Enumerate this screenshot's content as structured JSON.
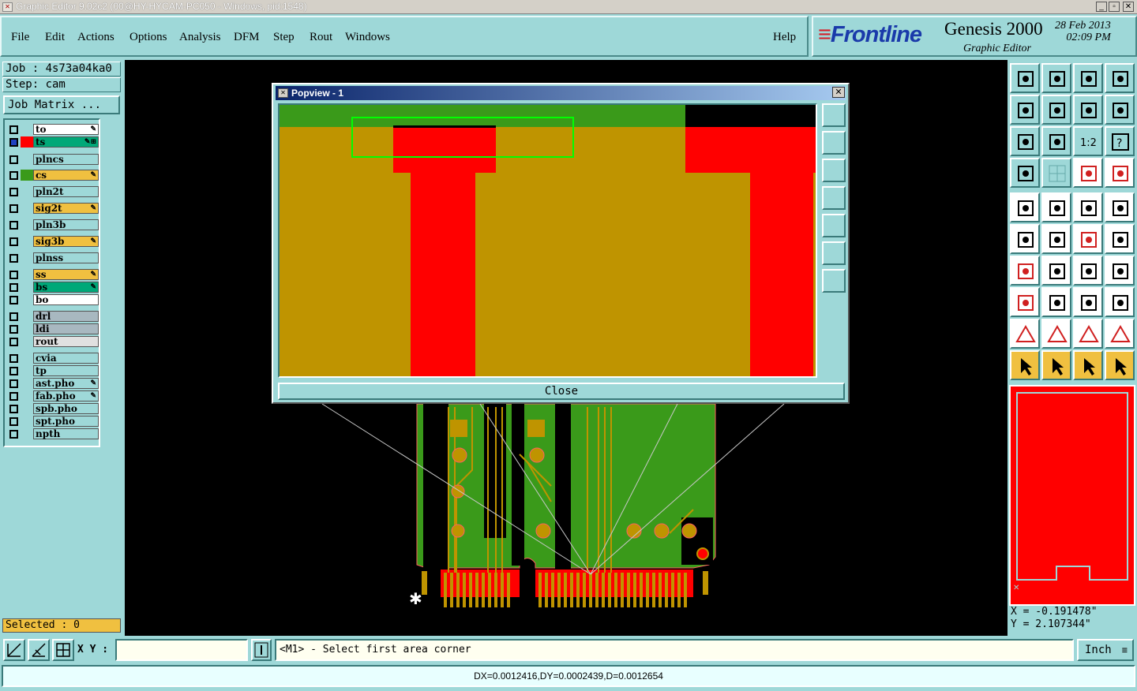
{
  "window": {
    "title": "Graphic Editor 9.02c2 (00@HY-HYCAM-PC050 - Windows, pid:1548)"
  },
  "menu": [
    "File",
    "Edit",
    "Actions",
    "Options",
    "Analysis",
    "DFM",
    "Step",
    "Rout",
    "Windows"
  ],
  "help_label": "Help",
  "brand": {
    "logo": "Frontline",
    "product": "Genesis 2000",
    "subtitle": "Graphic Editor",
    "date": "28 Feb 2013",
    "time": "02:09 PM"
  },
  "job": {
    "job_label": "Job : 4s73a04ka0",
    "step_label": "Step: cam",
    "matrix_button": "Job Matrix ..."
  },
  "layers": [
    {
      "name": "to",
      "bg": "#ffffff",
      "swatch": "",
      "mark": "✎"
    },
    {
      "name": "ts",
      "bg": "#00a878",
      "swatch": "#ff0000",
      "mark": "✎⊞",
      "active": true
    },
    {
      "name": "plncs",
      "bg": "#9ed8d8",
      "swatch": "",
      "mark": ""
    },
    {
      "name": "cs",
      "bg": "#f0c040",
      "swatch": "#3a9a1a",
      "mark": "✎"
    },
    {
      "name": "pln2t",
      "bg": "#9ed8d8",
      "swatch": "",
      "mark": ""
    },
    {
      "name": "sig2t",
      "bg": "#f0c040",
      "swatch": "",
      "mark": "✎"
    },
    {
      "name": "pln3b",
      "bg": "#9ed8d8",
      "swatch": "",
      "mark": ""
    },
    {
      "name": "sig3b",
      "bg": "#f0c040",
      "swatch": "",
      "mark": "✎"
    },
    {
      "name": "plnss",
      "bg": "#9ed8d8",
      "swatch": "",
      "mark": ""
    },
    {
      "name": "ss",
      "bg": "#f0c040",
      "swatch": "",
      "mark": "✎"
    },
    {
      "name": "bs",
      "bg": "#00a878",
      "swatch": "",
      "mark": "✎"
    },
    {
      "name": "bo",
      "bg": "#ffffff",
      "swatch": "",
      "mark": ""
    },
    {
      "name": "drl",
      "bg": "#a8b8c0",
      "swatch": "",
      "mark": ""
    },
    {
      "name": "ldi",
      "bg": "#a8b8c0",
      "swatch": "",
      "mark": ""
    },
    {
      "name": "rout",
      "bg": "#e0e0e0",
      "swatch": "",
      "mark": ""
    },
    {
      "name": "cvia",
      "bg": "#9ed8d8",
      "swatch": "",
      "mark": ""
    },
    {
      "name": "tp",
      "bg": "#9ed8d8",
      "swatch": "",
      "mark": ""
    },
    {
      "name": "ast.pho",
      "bg": "#9ed8d8",
      "swatch": "",
      "mark": "✎"
    },
    {
      "name": "fab.pho",
      "bg": "#9ed8d8",
      "swatch": "",
      "mark": "✎"
    },
    {
      "name": "spb.pho",
      "bg": "#9ed8d8",
      "swatch": "",
      "mark": ""
    },
    {
      "name": "spt.pho",
      "bg": "#9ed8d8",
      "swatch": "",
      "mark": ""
    },
    {
      "name": "npth",
      "bg": "#9ed8d8",
      "swatch": "",
      "mark": ""
    }
  ],
  "selected_label": "Selected : 0",
  "popview": {
    "title": "Popview - 1",
    "close_label": "Close"
  },
  "right_tools": {
    "row_icons": [
      "zoom-up",
      "zoom-down",
      "home",
      "split",
      "pan-left",
      "pan-right",
      "undo-view",
      "redo-view",
      "fit",
      "center",
      "scale-1-2",
      "help",
      "measure",
      "grid",
      "snap",
      "snap-active",
      "select-pad",
      "clip",
      "ruler",
      "drill",
      "net",
      "cross",
      "line-red",
      "line-blue",
      "angle",
      "diagonal",
      "arc",
      "feature",
      "pad-red",
      "dash",
      "dimension",
      "shapes",
      "triangle-1",
      "triangle-2",
      "triangle-3",
      "triangle-4",
      "pointer",
      "pointer-box",
      "pointer-orange",
      "route"
    ]
  },
  "coords": {
    "x": "X = -0.191478\"",
    "y": "Y = 2.107344\""
  },
  "bottom": {
    "xy_label": "X Y :",
    "xy_value": "",
    "message": "<M1> - Select first area corner",
    "unit": "Inch"
  },
  "status": "DX=0.0012416,DY=0.0002439,D=0.0012654",
  "colors": {
    "copper": "#bf9400",
    "red": "#ff0000",
    "green": "#3a9a1a",
    "panel": "#9ed8d8"
  }
}
